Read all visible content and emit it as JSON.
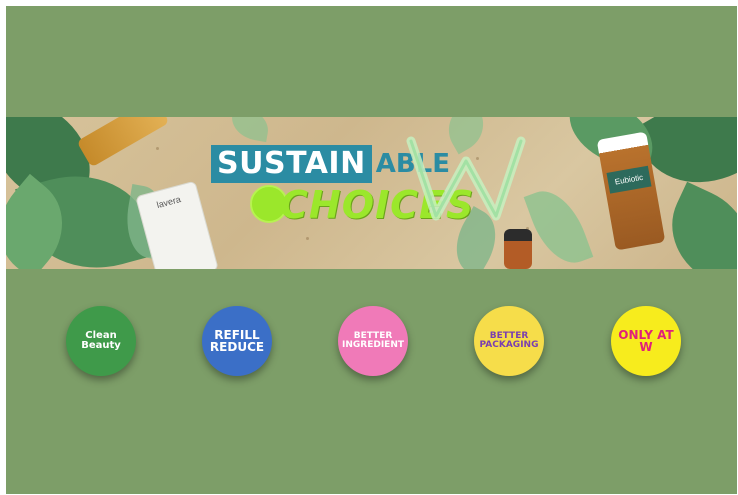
{
  "banner": {
    "title_part1": "SUSTAIN",
    "title_part2": "ABLE",
    "title_part3": "CHOICES",
    "logo_letter": "W",
    "product_labels": {
      "tube": "lavera",
      "bottle": "Eubiotic"
    }
  },
  "badges": [
    {
      "label": "Clean\nBeauty",
      "color": "#3f9a4a",
      "text_color": "#ffffff",
      "icon": "leaf-icon"
    },
    {
      "label": "REFILL\nREDUCE",
      "color": "#3b6fc7",
      "text_color": "#ffffff",
      "icon": "recycle-icon"
    },
    {
      "label": "BETTER\nINGREDIENT",
      "color": "#f07ab8",
      "text_color": "#ffffff",
      "icon": "leaf-icon"
    },
    {
      "label": "BETTER\nPACKAGING",
      "color": "#f6dd4a",
      "text_color": "#7a3fb0",
      "icon": "box-icon"
    },
    {
      "label": "ONLY AT\nW",
      "color": "#f7ec1d",
      "text_color": "#e0207a",
      "icon": "w-logo-icon"
    }
  ]
}
